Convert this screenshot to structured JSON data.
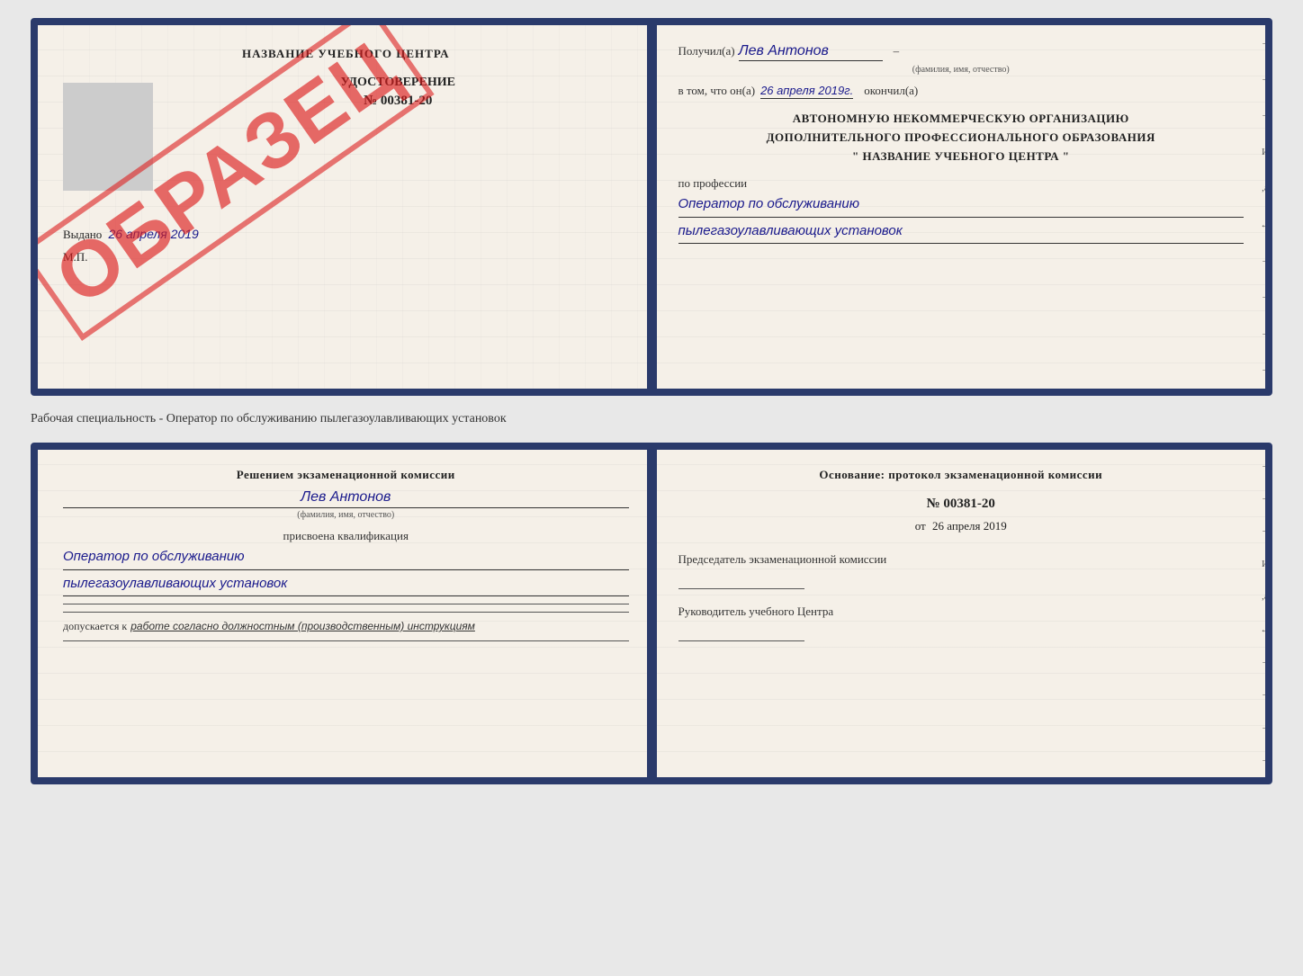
{
  "page": {
    "background": "#e8e8e8"
  },
  "cert_top": {
    "left": {
      "school_name": "НАЗВАНИЕ УЧЕБНОГО ЦЕНТРА",
      "stamp": "ОБРАЗЕЦ",
      "doc_type": "УДОСТОВЕРЕНИЕ",
      "doc_number": "№ 00381-20",
      "issued_label": "Выдано",
      "issued_date": "26 апреля 2019",
      "mp_label": "М.П."
    },
    "right": {
      "received_prefix": "Получил(а)",
      "received_name": "Лев Антонов",
      "fio_label": "(фамилия, имя, отчество)",
      "date_prefix": "в том, что он(а)",
      "date_value": "26 апреля 2019г.",
      "finished_label": "окончил(а)",
      "org_line1": "АВТОНОМНУЮ НЕКОММЕРЧЕСКУЮ ОРГАНИЗАЦИЮ",
      "org_line2": "ДОПОЛНИТЕЛЬНОГО ПРОФЕССИОНАЛЬНОГО ОБРАЗОВАНИЯ",
      "org_line3": "\"  НАЗВАНИЕ УЧЕБНОГО ЦЕНТРА  \"",
      "profession_label": "по профессии",
      "profession_line1": "Оператор по обслуживанию",
      "profession_line2": "пылегазоулавливающих установок"
    },
    "side_dashes": [
      "–",
      "–",
      "–",
      "И",
      ",а",
      "←",
      "–",
      "–",
      "–",
      "–"
    ]
  },
  "between_label": "Рабочая специальность - Оператор по обслуживанию пылегазоулавливающих установок",
  "cert_bottom": {
    "left": {
      "decision_text": "Решением экзаменационной комиссии",
      "person_name": "Лев Антонов",
      "fio_label": "(фамилия, имя, отчество)",
      "assigned_label": "присвоена квалификация",
      "qual_line1": "Оператор по обслуживанию",
      "qual_line2": "пылегазоулавливающих установок",
      "allowed_prefix": "допускается к",
      "allowed_italic": "работе согласно должностным (производственным) инструкциям"
    },
    "right": {
      "basis_text": "Основание: протокол экзаменационной комиссии",
      "protocol_number": "№  00381-20",
      "protocol_date_prefix": "от",
      "protocol_date": "26 апреля 2019",
      "chairman_label": "Председатель экзаменационной комиссии",
      "director_label": "Руководитель учебного Центра"
    },
    "side_dashes": [
      "–",
      "–",
      "–",
      "И",
      ",а",
      "←",
      "–",
      "–",
      "–",
      "–"
    ]
  }
}
